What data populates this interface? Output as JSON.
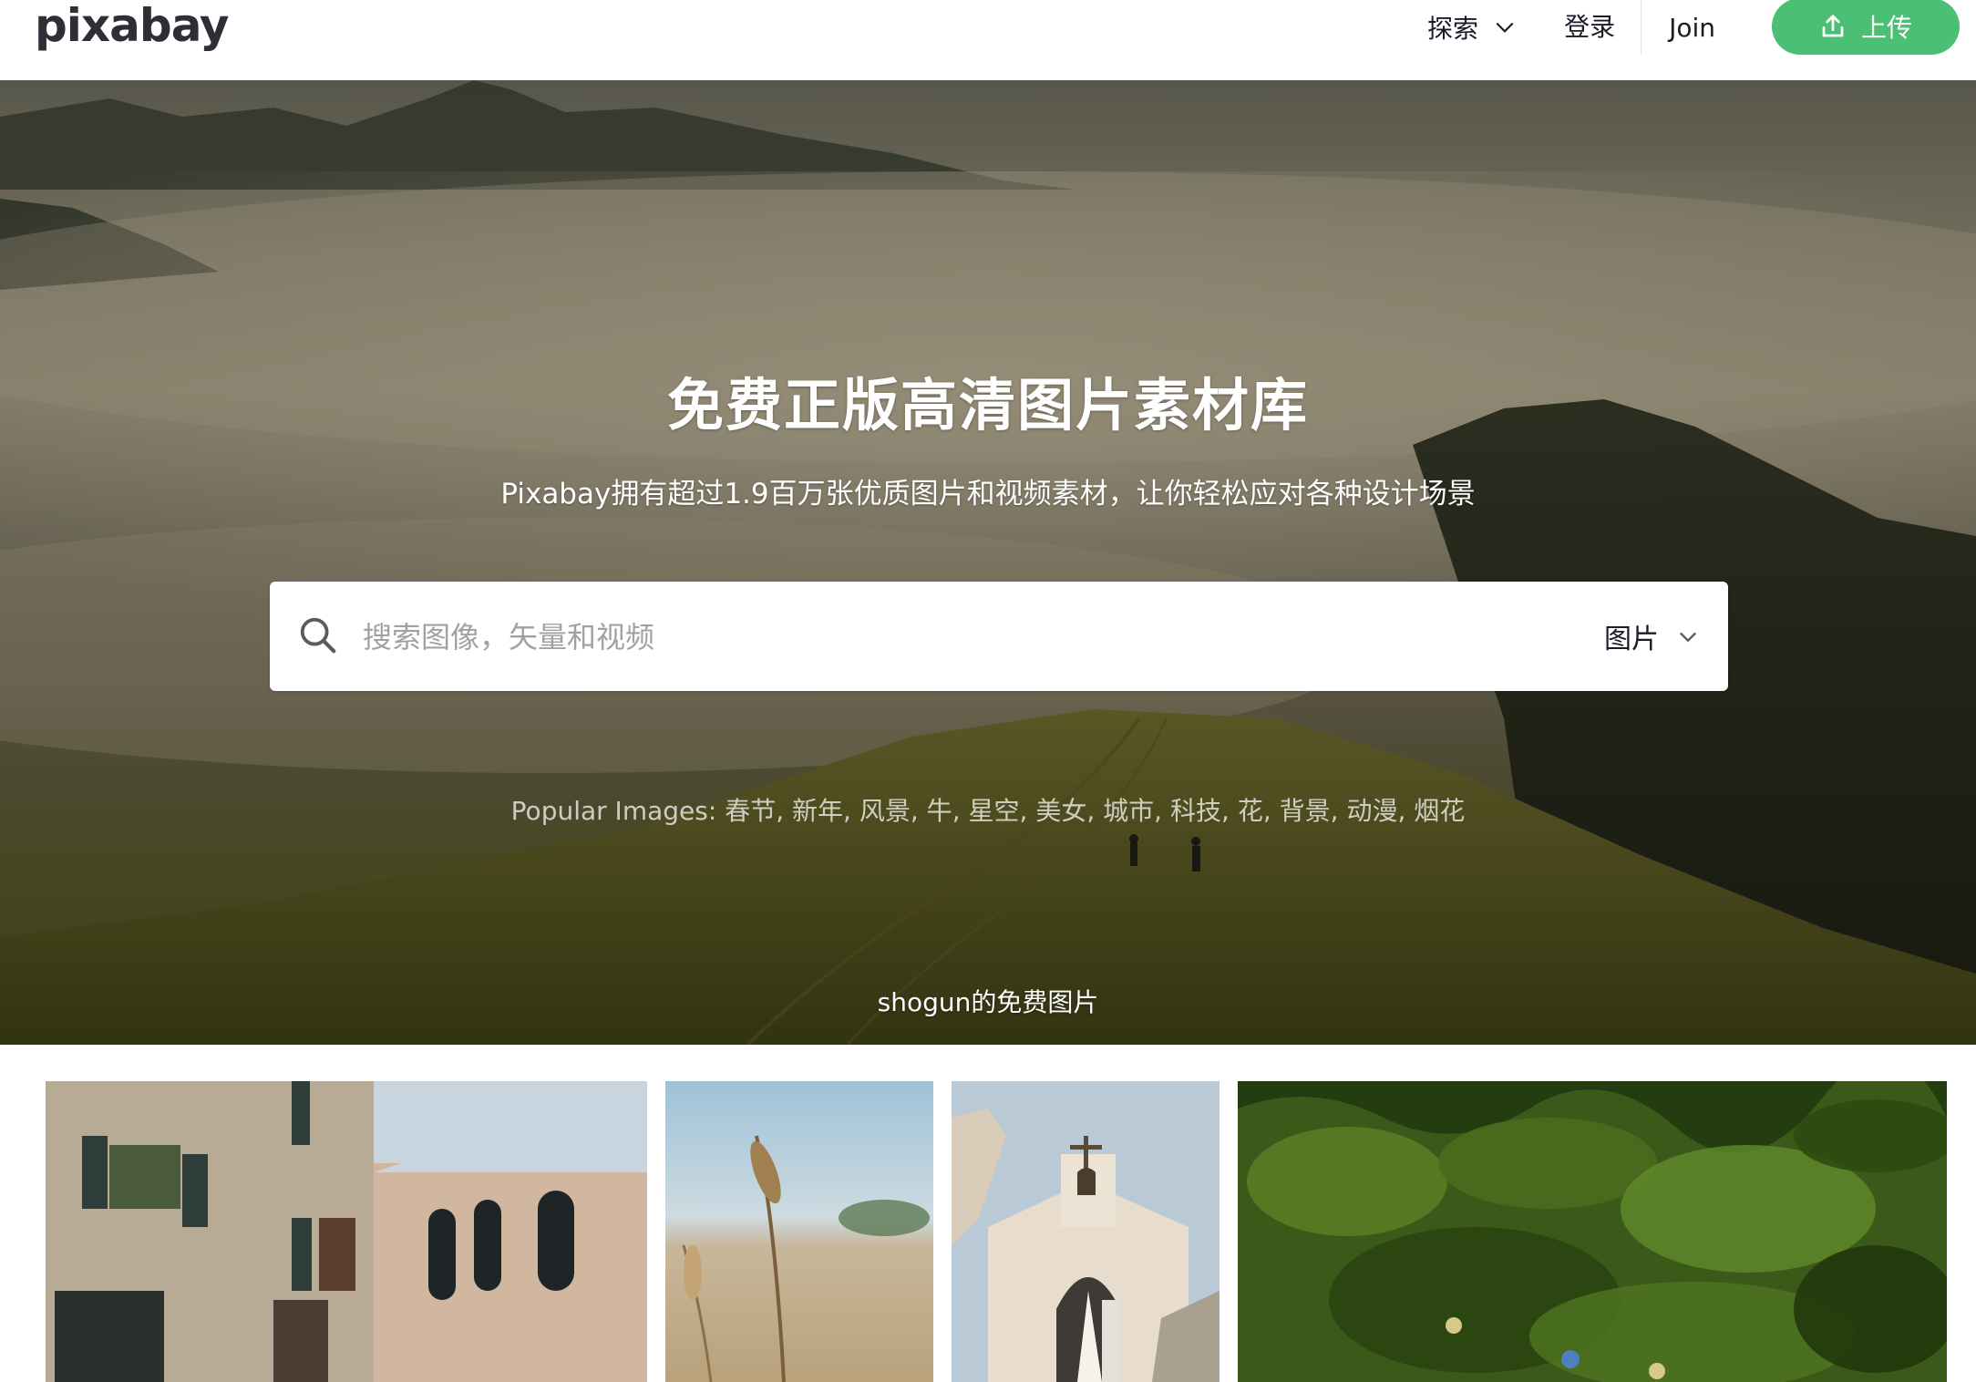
{
  "header": {
    "logo": "pixabay",
    "nav": {
      "explore": "探索",
      "login": "登录",
      "join": "Join",
      "upload": "上传"
    }
  },
  "hero": {
    "title": "免费正版高清图片素材库",
    "subtitle": "Pixabay拥有超过1.9百万张优质图片和视频素材，让你轻松应对各种设计场景",
    "search": {
      "placeholder": "搜索图像，矢量和视频",
      "value": "",
      "type_selected": "图片"
    },
    "popular": {
      "label": "Popular Images:",
      "tags": [
        "春节",
        "新年",
        "风景",
        "牛",
        "星空",
        "美女",
        "城市",
        "科技",
        "花",
        "背景",
        "动漫",
        "烟花"
      ]
    },
    "credit": "shogun的免费图片"
  },
  "grid": {
    "images": [
      {
        "subject": "venice-buildings"
      },
      {
        "subject": "wheat-field"
      },
      {
        "subject": "chapel-wedding"
      },
      {
        "subject": "green-grass-aerial"
      }
    ]
  },
  "colors": {
    "accent": "#4bbf73",
    "text": "#191b26",
    "placeholder": "#a1a1a1"
  },
  "icons": {
    "search": "search-icon",
    "upload": "upload-icon",
    "chevron": "chevron-down-icon"
  }
}
